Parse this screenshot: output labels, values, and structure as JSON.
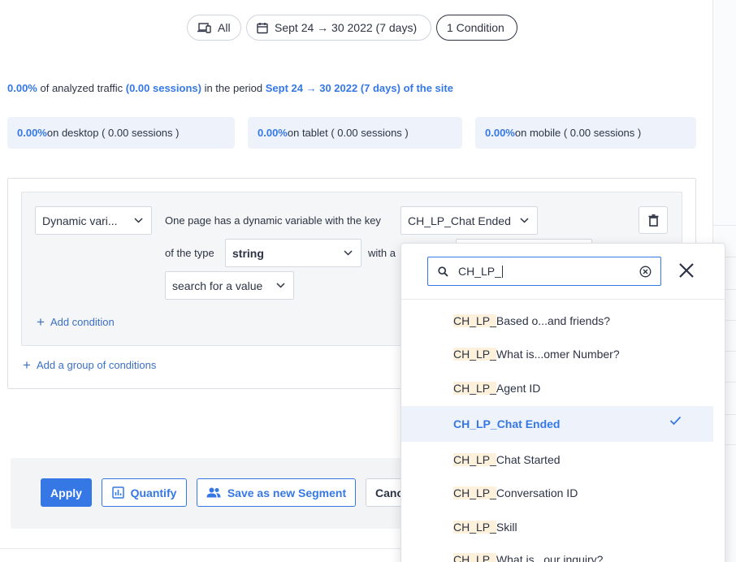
{
  "filters": {
    "device_label": "All",
    "date_label": "Sept 24 → 30 2022 (7 days)",
    "condition_label": "1 Condition"
  },
  "summary": {
    "pct": "0.00%",
    "text1": " of analyzed traffic ",
    "sessions": "(0.00 sessions)",
    "text2": " in the period ",
    "period": "Sept 24 → 30 2022 (7 days) of the site"
  },
  "stats": [
    {
      "pct": "0.00%",
      "text": " on desktop ( 0.00 sessions )"
    },
    {
      "pct": "0.00%",
      "text": " on tablet ( 0.00 sessions )"
    },
    {
      "pct": "0.00%",
      "text": " on mobile ( 0.00 sessions )"
    }
  ],
  "condition": {
    "type_select": "Dynamic vari...",
    "sentence_1": "One page has a dynamic variable with the key",
    "key_select": "CH_LP_Chat Ended",
    "of_the_type": "of the type",
    "type_value": "string",
    "with_a": "with a",
    "value_select": "search for a value",
    "add_condition": "Add condition",
    "add_group": "Add a group of conditions"
  },
  "footer": {
    "apply": "Apply",
    "quantify": "Quantify",
    "save_segment": "Save as new Segment",
    "cancel": "Canc"
  },
  "dropdown": {
    "search_value": "CH_LP_",
    "match": "CH_LP_",
    "options": [
      {
        "rest": "Based o...and friends?"
      },
      {
        "rest": "What is...omer Number?"
      },
      {
        "rest": "Agent ID"
      },
      {
        "rest": "Chat Ended",
        "selected": true
      },
      {
        "rest": "Chat Started"
      },
      {
        "rest": "Conversation ID"
      },
      {
        "rest": "Skill"
      },
      {
        "rest": "What is...our inquiry?"
      }
    ]
  },
  "colors": {
    "accent": "#3578e5",
    "highlight": "#fdf1dc",
    "stat_bg": "#eef3fb"
  }
}
